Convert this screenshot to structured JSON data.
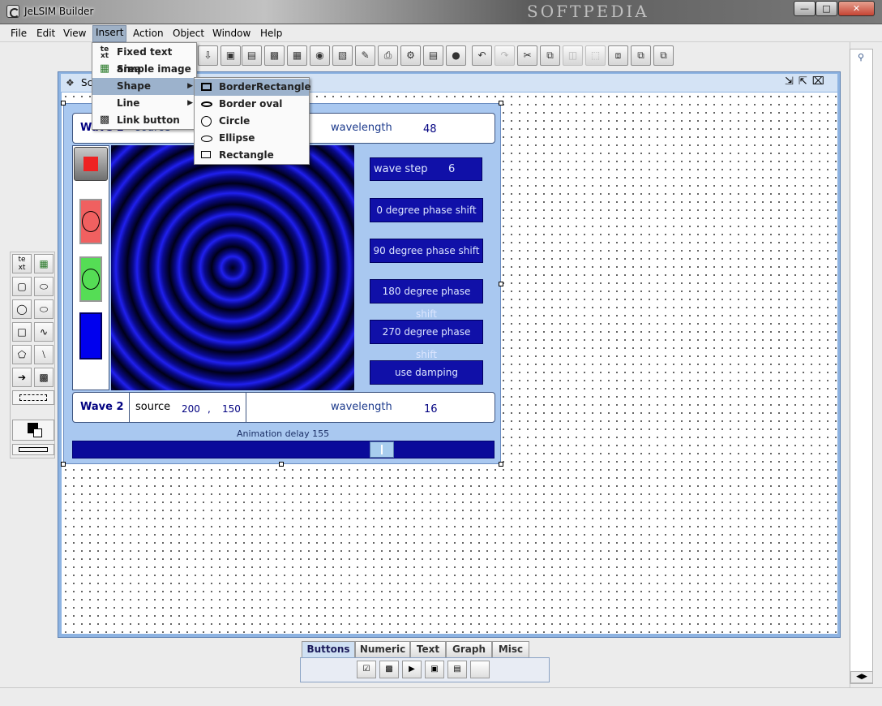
{
  "window": {
    "title": "JeLSIM Builder",
    "watermark": "SOFTPEDIA",
    "controls": [
      "minimize",
      "maximize",
      "close"
    ]
  },
  "menubar": {
    "items": [
      {
        "label": "File"
      },
      {
        "label": "Edit"
      },
      {
        "label": "View"
      },
      {
        "label": "Insert"
      },
      {
        "label": "Action"
      },
      {
        "label": "Object"
      },
      {
        "label": "Window"
      },
      {
        "label": "Help"
      }
    ],
    "active": "Insert"
  },
  "insert_menu": {
    "items": [
      {
        "label": "Fixed text area",
        "icon": "text-icon"
      },
      {
        "label": "Simple image",
        "icon": "image-icon"
      },
      {
        "label": "Shape",
        "icon": "",
        "submenu": true
      },
      {
        "label": "Line",
        "icon": "",
        "submenu": true
      },
      {
        "label": "Link button",
        "icon": "link-icon"
      }
    ],
    "highlighted": "Shape"
  },
  "shape_menu": {
    "items": [
      {
        "label": "BorderRectangle",
        "icon": "border-rectangle-icon"
      },
      {
        "label": "Border oval",
        "icon": "border-oval-icon"
      },
      {
        "label": "Circle",
        "icon": "circle-icon"
      },
      {
        "label": "Ellipse",
        "icon": "ellipse-icon"
      },
      {
        "label": "Rectangle",
        "icon": "rectangle-icon"
      }
    ],
    "highlighted": "BorderRectangle"
  },
  "inner_window": {
    "title": "Sc"
  },
  "sim": {
    "wave1": {
      "label": "Wave 1",
      "source_label": "source",
      "wavelength_label": "wavelength",
      "wavelength": "48"
    },
    "wave2": {
      "label": "Wave 2",
      "source_label": "source",
      "source_x": "200",
      "sep": ",",
      "source_y": "150",
      "wavelength_label": "wavelength",
      "wavelength": "16"
    },
    "wave_step": {
      "label": "wave step",
      "value": "6"
    },
    "buttons": [
      "0 degree phase shift",
      "90 degree phase shift",
      "180 degree phase shift",
      "270 degree phase shift",
      "use damping"
    ],
    "animation_label": "Animation delay",
    "animation_value": "155"
  },
  "bottom_tabs": {
    "tabs": [
      "Buttons",
      "Numeric",
      "Text",
      "Graph",
      "Misc"
    ],
    "selected": "Buttons"
  },
  "colors": {
    "accent": "#1010a8",
    "panel": "#a9c8f0",
    "frame": "#8db3e2"
  }
}
